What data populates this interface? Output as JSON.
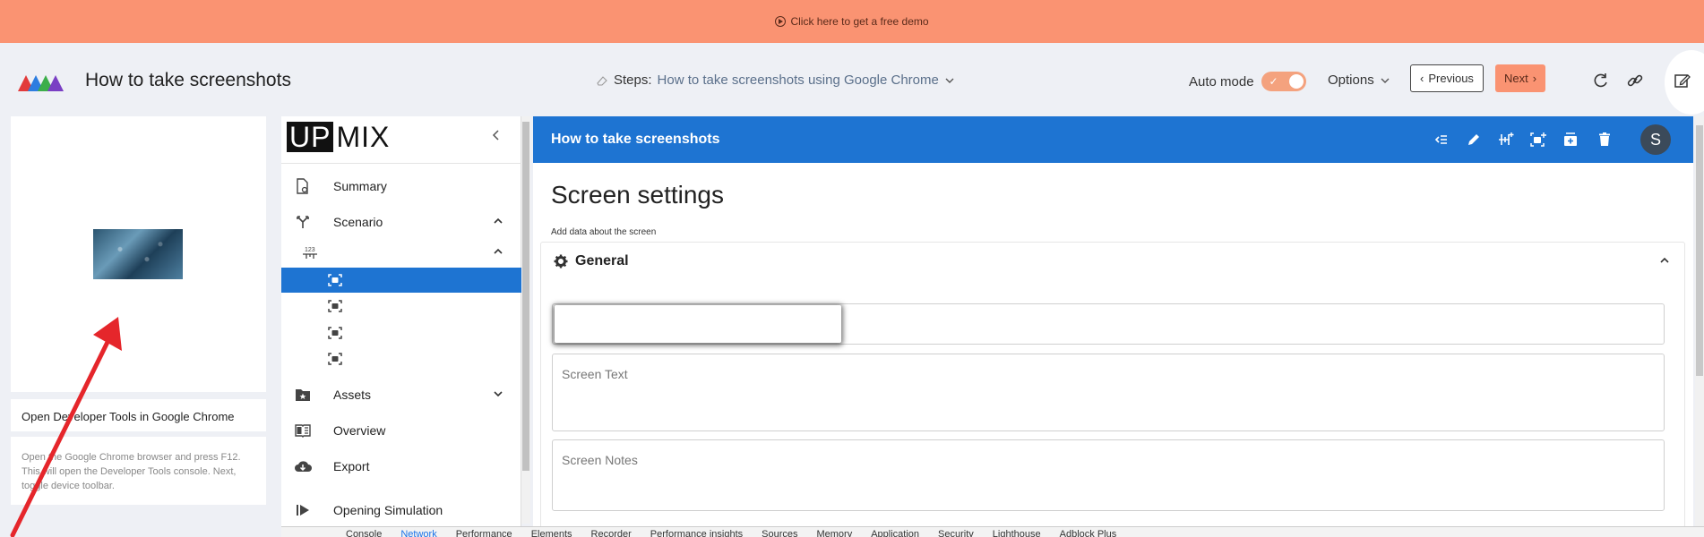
{
  "banner": {
    "text": "Click here to get a free demo"
  },
  "header": {
    "app_title": "How to take screenshots",
    "steps_label": "Steps:",
    "steps_value": "How to take screenshots using Google Chrome",
    "auto_mode_label": "Auto mode",
    "auto_mode_on": true,
    "options_label": "Options",
    "previous_label": "Previous",
    "next_label": "Next"
  },
  "step_card": {
    "title": "Open Developer Tools in Google Chrome",
    "description": "Open the Google Chrome browser and press F12. This will open the Developer Tools console. Next, toggle device toolbar."
  },
  "sidebar": {
    "brand_up": "UP",
    "brand_mix": "MIX",
    "items": [
      {
        "label": "Summary",
        "icon": "document-gear-icon"
      },
      {
        "label": "Scenario",
        "icon": "fork-icon",
        "expanded": true
      },
      {
        "label": "",
        "icon": "numbered-steps-icon",
        "expanded": true
      },
      {
        "label": "",
        "icon": "screenshot-icon",
        "active": true
      },
      {
        "label": "",
        "icon": "screenshot-icon"
      },
      {
        "label": "",
        "icon": "screenshot-icon"
      },
      {
        "label": "",
        "icon": "screenshot-icon"
      },
      {
        "label": "Assets",
        "icon": "folder-star-icon",
        "expanded": false
      },
      {
        "label": "Overview",
        "icon": "book-icon"
      },
      {
        "label": "Export",
        "icon": "cloud-download-icon"
      },
      {
        "label": "Opening Simulation",
        "icon": "play-bar-icon"
      }
    ]
  },
  "main": {
    "topbar_title": "How to take screenshots",
    "avatar_initial": "S",
    "page_title": "Screen settings",
    "page_subtitle": "Add data about the screen",
    "section_title": "General",
    "screen_text_placeholder": "Screen Text",
    "screen_notes_placeholder": "Screen Notes"
  },
  "devtools": {
    "tabs": [
      "Console",
      "Network",
      "Performance",
      "Elements",
      "Recorder",
      "Performance insights",
      "Sources",
      "Memory",
      "Application",
      "Security",
      "Lighthouse",
      "Adblock Plus"
    ],
    "active_tab": "Network"
  },
  "colors": {
    "banner": "#fa9372",
    "accent_blue": "#1e74d2",
    "next_button": "#fa9372"
  }
}
